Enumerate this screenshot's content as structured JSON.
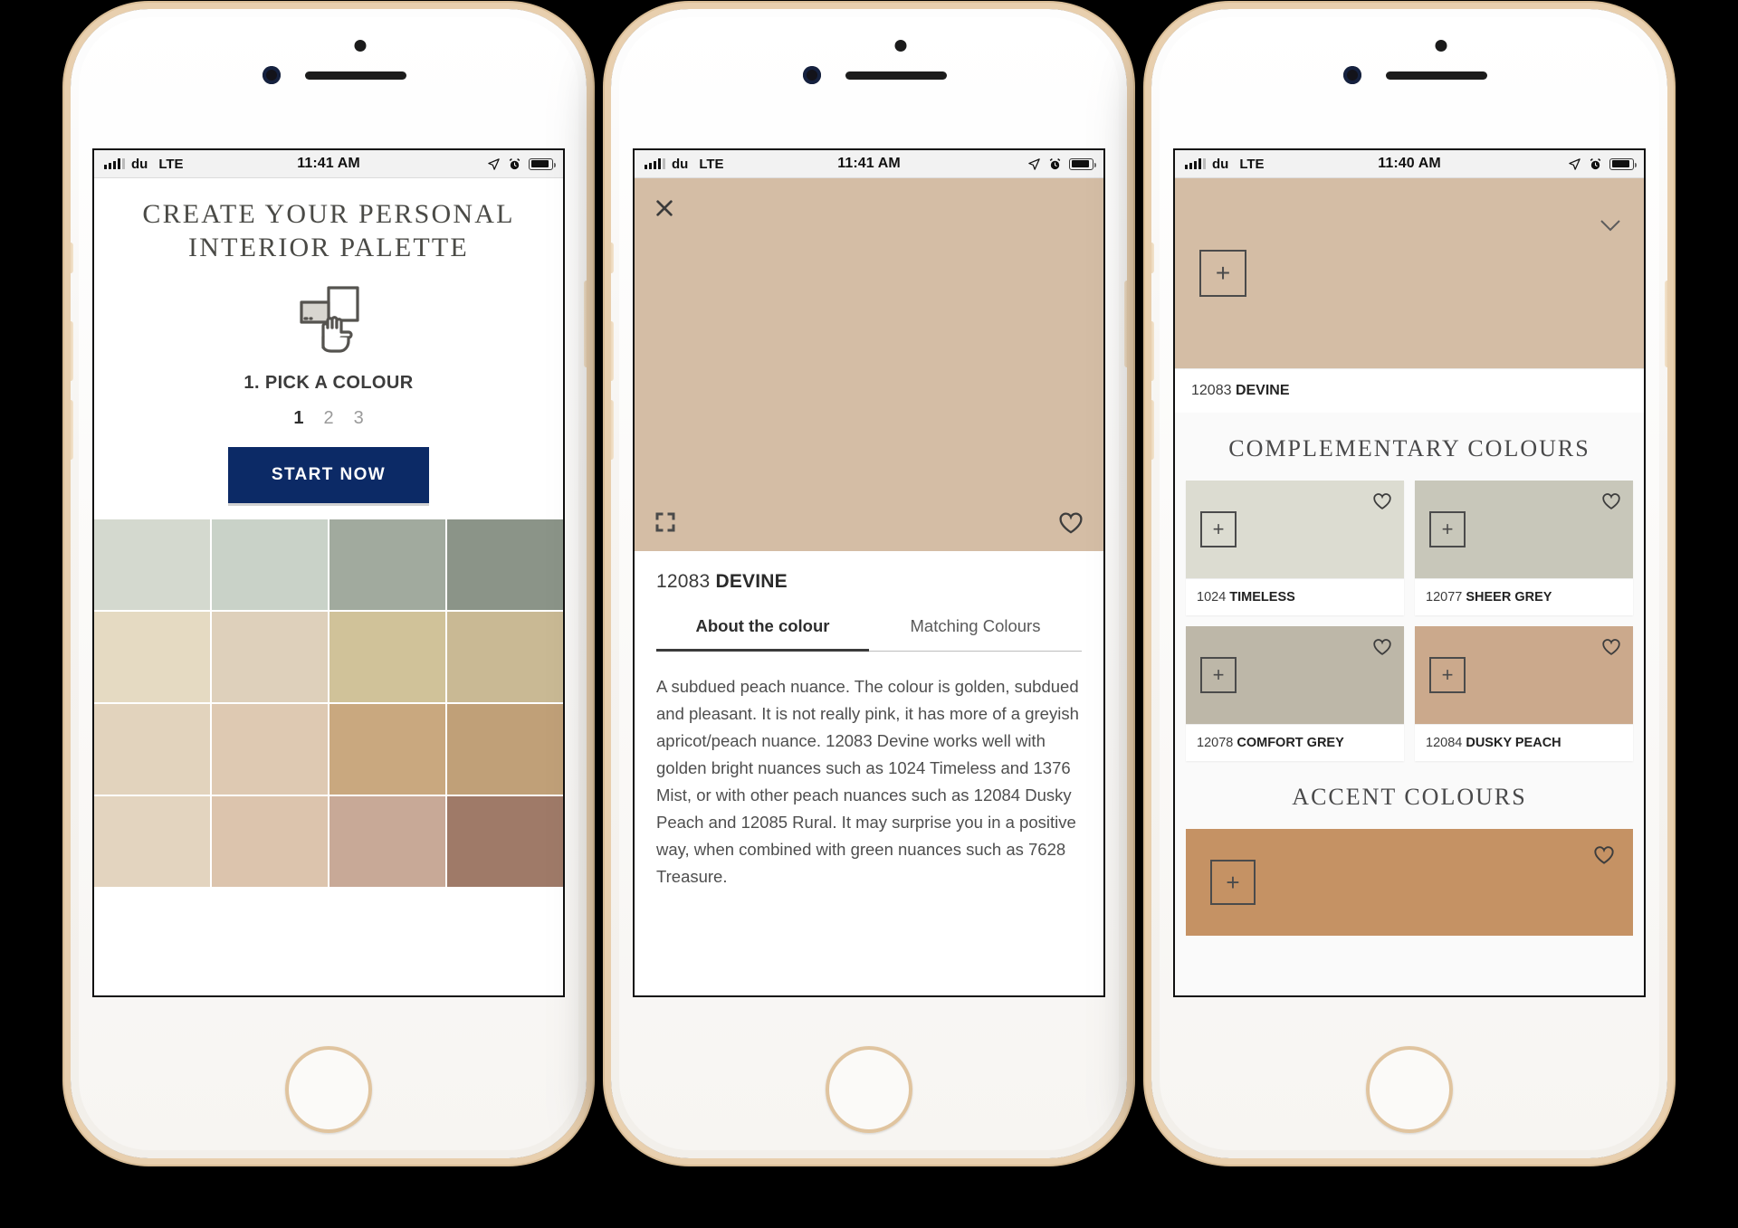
{
  "statusbar": {
    "carrier": "du",
    "network": "LTE",
    "time_1": "11:41 AM",
    "time_2": "11:41 AM",
    "time_3": "11:40 AM",
    "icons": [
      "signal-bars-icon",
      "location-arrow-icon",
      "alarm-clock-icon",
      "battery-icon"
    ]
  },
  "phone1": {
    "title_line1": "CREATE YOUR PERSONAL",
    "title_line2": "INTERIOR PALETTE",
    "hand_icon": "tap-hand-icon",
    "step_label": "1. PICK A COLOUR",
    "steps": [
      {
        "num": "1",
        "active": true
      },
      {
        "num": "2",
        "active": false
      },
      {
        "num": "3",
        "active": false
      }
    ],
    "start_button": "START NOW",
    "accent_color": "#0c2a66",
    "swatches": [
      "#d4d9cf",
      "#c9d2c8",
      "#a1aa9e",
      "#8b9488",
      "#e5dac2",
      "#ded0bb",
      "#d0c299",
      "#c9b994",
      "#e2d3bd",
      "#dec9b2",
      "#c9a87f",
      "#c0a078",
      "#e3d4bf",
      "#dcc4ad",
      "#c8a997",
      "#9f7a68"
    ]
  },
  "phone2": {
    "hero_color": "#d4bda5",
    "close_icon": "close-x-icon",
    "expand_icon": "expand-fullscreen-icon",
    "heart_icon": "heart-outline-icon",
    "colour_code": "12083",
    "colour_name": "DEVINE",
    "tabs": [
      {
        "label": "About the colour",
        "active": true
      },
      {
        "label": "Matching Colours",
        "active": false
      }
    ],
    "description": "A subdued peach nuance. The colour is golden, subdued and pleasant. It is not really pink, it has more of a greyish apricot/peach nuance. 12083 Devine works well with golden bright nuances such as 1024 Timeless and 1376 Mist, or with other peach nuances such as 12084 Dusky Peach and 12085 Rural. It may surprise you in a positive way, when combined with green nuances such as 7628 Treasure."
  },
  "phone3": {
    "main": {
      "color": "#d4bda5",
      "plus_icon": "plus-square-icon",
      "chevron_icon": "chevron-down-icon",
      "code": "12083",
      "name": "DEVINE"
    },
    "complementary_heading": "COMPLEMENTARY COLOURS",
    "complementary": [
      {
        "color": "#dcdcd1",
        "code": "1024",
        "name": "TIMELESS"
      },
      {
        "color": "#c8c7ba",
        "code": "12077",
        "name": "SHEER GREY"
      },
      {
        "color": "#bdb7a8",
        "code": "12078",
        "name": "COMFORT GREY"
      },
      {
        "color": "#cba98c",
        "code": "12084",
        "name": "DUSKY PEACH"
      }
    ],
    "accent_heading": "ACCENT COLOURS",
    "accent": [
      {
        "color": "#c59264",
        "code": "",
        "name": ""
      }
    ],
    "plus_icon": "plus-square-icon",
    "heart_icon": "heart-outline-icon"
  }
}
